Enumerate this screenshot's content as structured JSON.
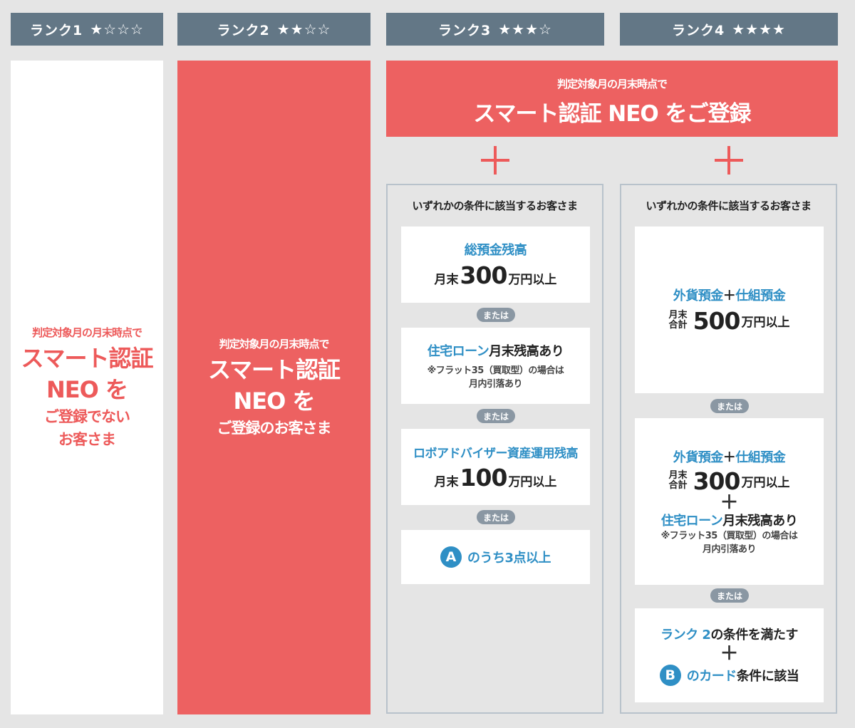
{
  "headers": [
    {
      "label": "ランク1",
      "stars": "★☆☆☆"
    },
    {
      "label": "ランク2",
      "stars": "★★☆☆"
    },
    {
      "label": "ランク3",
      "stars": "★★★☆"
    },
    {
      "label": "ランク4",
      "stars": "★★★★"
    }
  ],
  "rank1": {
    "line1": "判定対象月の月末時点で",
    "line2": "スマート認証",
    "line3": "NEO を",
    "line4": "ご登録でない",
    "line5": "お客さま"
  },
  "rank2": {
    "line1": "判定対象月の月末時点で",
    "line2": "スマート認証",
    "line3": "NEO を",
    "line4": "ご登録のお客さま"
  },
  "banner": {
    "line1": "判定対象月の月末時点で",
    "line2": "スマート認証 NEO をご登録"
  },
  "rank3": {
    "title": "いずれかの条件に該当するお客さま",
    "or_label": "または",
    "c1": {
      "title": "総預金残高",
      "pre": "月末",
      "num": "300",
      "post": "万円以上"
    },
    "c2": {
      "blue": "住宅ローン",
      "rest": "月末残高あり",
      "note1": "※フラット35（買取型）の場合は",
      "note2": "月内引落あり"
    },
    "c3": {
      "title": "ロボアドバイザー資産運用残高",
      "pre": "月末",
      "num": "100",
      "post": "万円以上"
    },
    "c4": {
      "badge": "A",
      "text": "のうち3点以上"
    }
  },
  "rank4": {
    "title": "いずれかの条件に該当するお客さま",
    "or_label": "または",
    "c1": {
      "a": "外貨預金",
      "plus": "＋",
      "b": "仕組預金",
      "s1": "月末",
      "s2": "合計",
      "num": "500",
      "post": "万円以上"
    },
    "c2": {
      "a": "外貨預金",
      "plus": "＋",
      "b": "仕組預金",
      "s1": "月末",
      "s2": "合計",
      "num": "300",
      "post": "万円以上",
      "plus2": "＋",
      "blue": "住宅ローン",
      "rest": "月末残高あり",
      "note1": "※フラット35（買取型）の場合は",
      "note2": "月内引落あり"
    },
    "c3": {
      "blue": "ランク 2",
      "rest": "の条件を満たす",
      "plus": "＋",
      "badge": "B",
      "blue2": "のカード",
      "rest2": "条件に該当"
    }
  }
}
